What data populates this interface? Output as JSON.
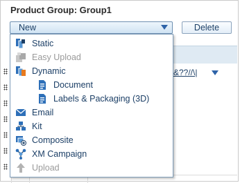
{
  "header": {
    "title": "Product Group: Group1"
  },
  "toolbar": {
    "new_label": "New",
    "delete_label": "Delete"
  },
  "grid": {
    "filter_text": "&??//\\|"
  },
  "menu": {
    "items": [
      {
        "label": "Static",
        "icon": "static-icon",
        "enabled": true
      },
      {
        "label": "Easy Upload",
        "icon": "easy-upload-icon",
        "enabled": false
      },
      {
        "label": "Dynamic",
        "icon": "dynamic-icon",
        "enabled": true
      },
      {
        "label": "Document",
        "icon": "document-icon",
        "enabled": true
      },
      {
        "label": "Labels & Packaging (3D)",
        "icon": "labels-packaging-icon",
        "enabled": true
      },
      {
        "label": "Email",
        "icon": "email-icon",
        "enabled": true
      },
      {
        "label": "Kit",
        "icon": "kit-icon",
        "enabled": true
      },
      {
        "label": "Composite",
        "icon": "composite-icon",
        "enabled": true
      },
      {
        "label": "XM Campaign",
        "icon": "xm-campaign-icon",
        "enabled": true
      },
      {
        "label": "Upload",
        "icon": "upload-icon",
        "enabled": false
      }
    ]
  }
}
